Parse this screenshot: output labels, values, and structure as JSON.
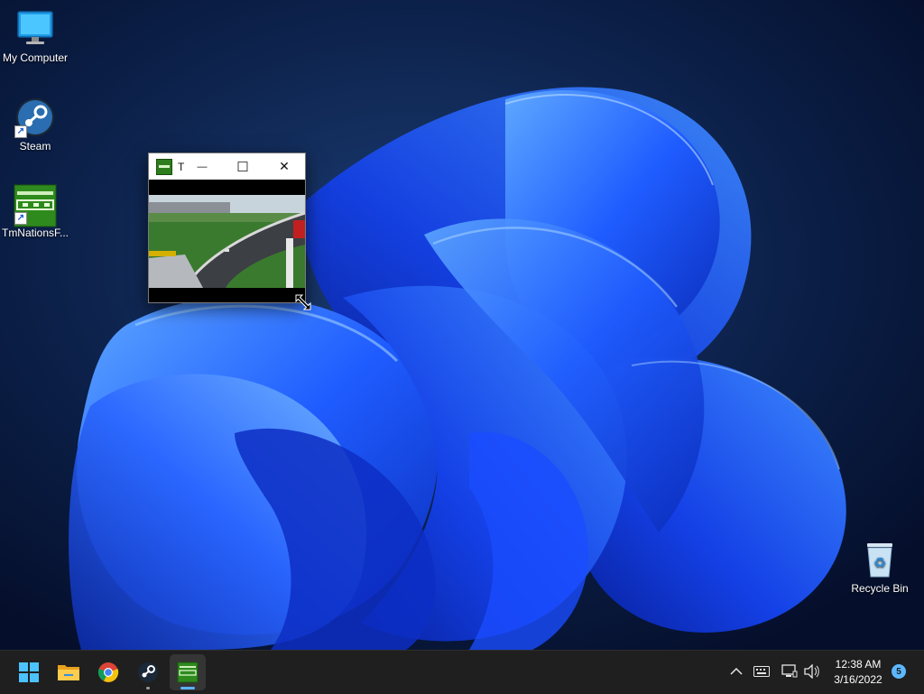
{
  "desktop": {
    "icons": [
      {
        "label": "My Computer"
      },
      {
        "label": "Steam"
      },
      {
        "label": "TmNationsF..."
      },
      {
        "label": "Recycle Bin"
      }
    ]
  },
  "game_window": {
    "title": "T",
    "minimize_symbol": "—",
    "maximize_symbol": "☐",
    "close_symbol": "✕"
  },
  "taskbar": {
    "apps": [
      {
        "name": "start",
        "icon": "windows-start-icon"
      },
      {
        "name": "file-explorer",
        "icon": "folder-icon"
      },
      {
        "name": "chrome",
        "icon": "chrome-icon"
      },
      {
        "name": "steam",
        "icon": "steam-icon"
      },
      {
        "name": "tmnations",
        "icon": "tmnations-icon",
        "active": true
      }
    ],
    "tray": {
      "chevron": "^",
      "time": "12:38 AM",
      "date": "3/16/2022",
      "notification_count": "5"
    }
  },
  "colors": {
    "accent": "#5ab0ff",
    "taskbar_bg": "#1f1f1f",
    "wallpaper_blue": "#1d4fff"
  }
}
